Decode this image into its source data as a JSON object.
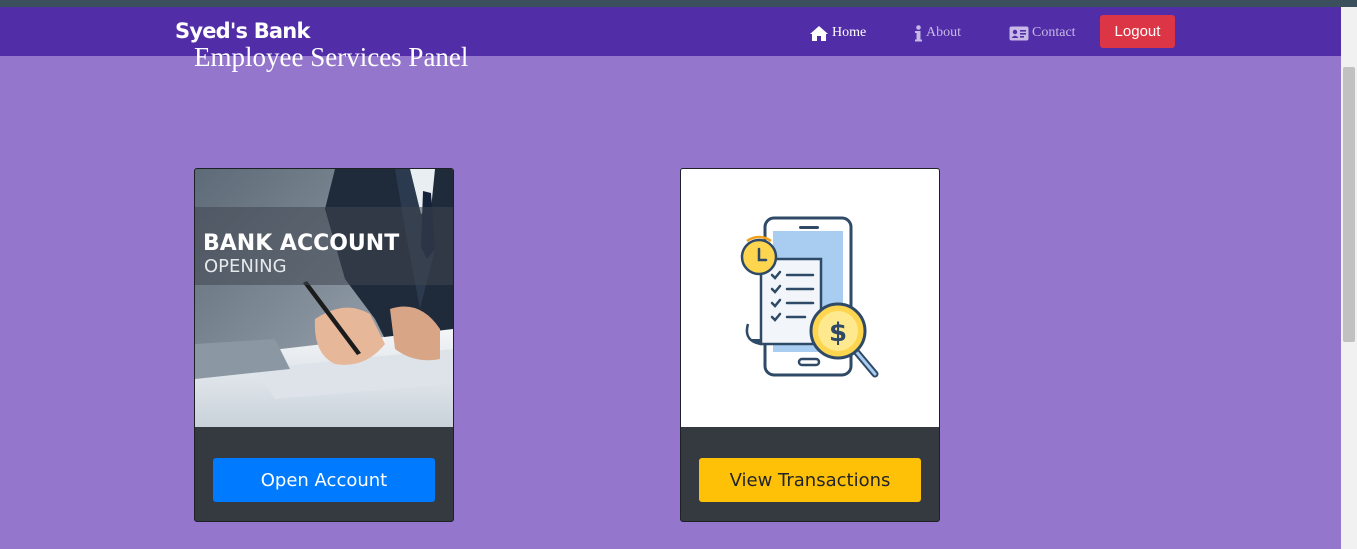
{
  "navbar": {
    "brand": "Syed's Bank",
    "links": [
      {
        "label": "Home",
        "icon": "home-icon",
        "active": true
      },
      {
        "label": "About",
        "icon": "info-icon",
        "active": false
      },
      {
        "label": "Contact",
        "icon": "contact-card-icon",
        "active": false
      }
    ],
    "logout_label": "Logout"
  },
  "main": {
    "title": "Employee Services Panel",
    "cards": [
      {
        "image_heading": "BANK ACCOUNT",
        "image_subheading": "OPENING",
        "button_label": "Open Account",
        "button_color": "#007bff"
      },
      {
        "image": "mobile-transactions-icon",
        "button_label": "View Transactions",
        "button_color": "#ffc107"
      }
    ]
  },
  "colors": {
    "navbar": "#512da8",
    "background": "#9576cd",
    "logout": "#dc3545",
    "card": "#343a40"
  }
}
